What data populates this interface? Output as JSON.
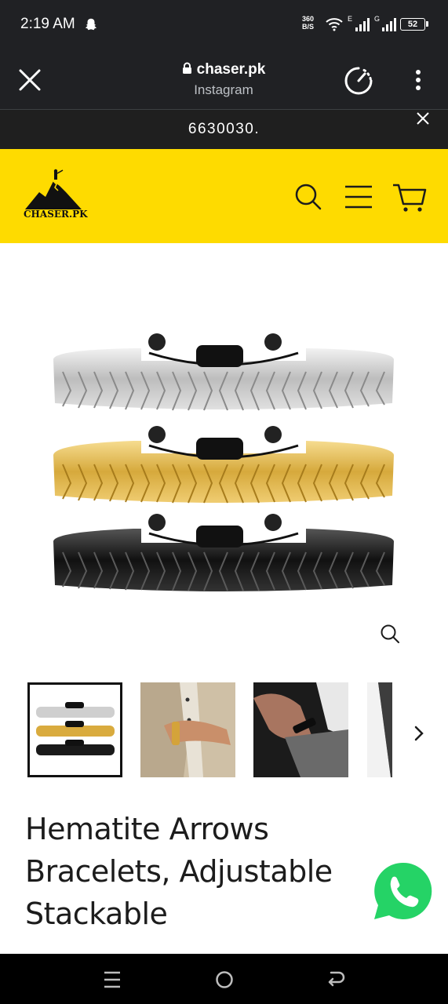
{
  "status_bar": {
    "time": "2:19 AM",
    "net_speed_value": "360",
    "net_speed_unit": "B/S",
    "signal1_label": "E",
    "signal2_label": "G",
    "battery": "52"
  },
  "browser": {
    "url": "chaser.pk",
    "subtitle": "Instagram"
  },
  "announcement": {
    "text": "6630030."
  },
  "header": {
    "logo_text": "CHASER.PK",
    "brand_color": "#fedb00"
  },
  "product": {
    "title": "Hematite Arrows Bracelets, Adjustable Stackable",
    "image_alt": "Three hematite arrow bracelets in silver, gold and black",
    "thumbnails": [
      {
        "name": "bracelet-set"
      },
      {
        "name": "wrist-gold-bracelet"
      },
      {
        "name": "wrist-black-bracelet"
      },
      {
        "name": "partial-fourth"
      }
    ]
  },
  "icons": {
    "close": "close-icon",
    "lock": "lock-icon",
    "speed": "speedometer-icon",
    "menu": "more-vert-icon",
    "search": "search-icon",
    "hamburger": "hamburger-icon",
    "cart": "cart-icon",
    "zoom": "zoom-icon",
    "next": "chevron-right-icon",
    "whatsapp": "whatsapp-icon"
  },
  "colors": {
    "status_bg": "#202124",
    "whatsapp_green": "#25d366",
    "text_dark": "#1c1c1c"
  }
}
